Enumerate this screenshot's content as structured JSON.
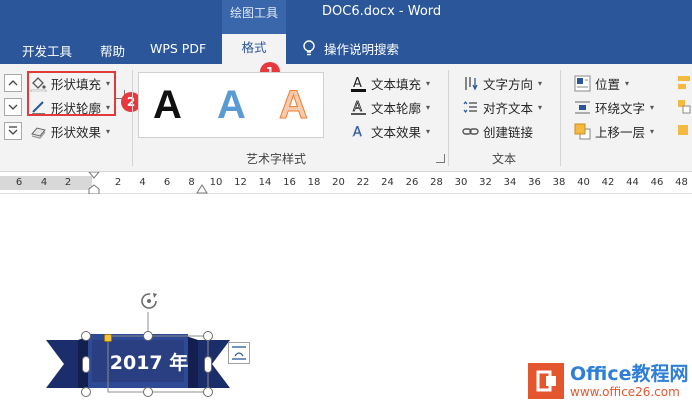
{
  "titlebar": {
    "context_tab": "绘图工具",
    "doc_title": "DOC6.docx  -  Word"
  },
  "tabs": {
    "items": [
      "开发工具",
      "帮助",
      "WPS PDF"
    ],
    "active": "格式",
    "tell_me": "操作说明搜索"
  },
  "ribbon": {
    "shape_styles": {
      "fill": "形状填充",
      "outline": "形状轮廓",
      "effects": "形状效果"
    },
    "wordart": {
      "label": "艺术字样式",
      "samples": [
        "A",
        "A",
        "A"
      ],
      "text_fill": "文本填充",
      "text_outline": "文本轮廓",
      "text_effects": "文本效果"
    },
    "text": {
      "label": "文本",
      "direction": "文字方向",
      "align": "对齐文本",
      "link": "创建链接"
    },
    "arrange": {
      "position": "位置",
      "wrap": "环绕文字",
      "forward": "上移一层"
    }
  },
  "annotations": {
    "badge1": "1",
    "badge2": "2"
  },
  "ruler": {
    "left_numbers": [
      "6",
      "4",
      "2"
    ],
    "right_numbers": [
      "2",
      "4",
      "6",
      "8",
      "10",
      "12",
      "14",
      "16",
      "18",
      "20",
      "22",
      "24",
      "26",
      "28",
      "30",
      "32",
      "34",
      "36",
      "38",
      "40",
      "42",
      "44",
      "46",
      "48"
    ]
  },
  "document": {
    "banner_text": "2017 年"
  },
  "watermark": {
    "main": "Office教程网",
    "sub": "www.office26.com"
  },
  "colors": {
    "accent": "#2b579a",
    "highlight": "#e03a3a",
    "banner_dark": "#1c2d6b",
    "banner_light": "#2f4a95"
  }
}
